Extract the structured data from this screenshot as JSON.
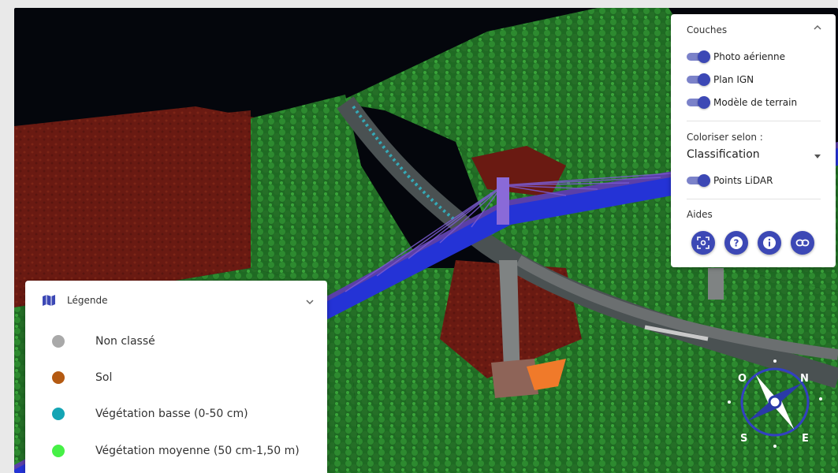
{
  "layers_panel": {
    "title": "Couches",
    "toggles": [
      {
        "label": "Photo aérienne",
        "on": true
      },
      {
        "label": "Plan IGN",
        "on": true
      },
      {
        "label": "Modèle de terrain",
        "on": true
      }
    ],
    "colorize_label": "Coloriser selon :",
    "colorize_value": "Classification",
    "lidar_toggle": {
      "label": "Points LiDAR",
      "on": true
    },
    "aides_label": "Aides",
    "aides_buttons": [
      "focus-icon",
      "help-icon",
      "info-icon",
      "link-icon"
    ]
  },
  "legend": {
    "title": "Légende",
    "items": [
      {
        "label": "Non classé",
        "color": "#a9a9a9"
      },
      {
        "label": "Sol",
        "color": "#b45a12"
      },
      {
        "label": "Végétation basse (0-50 cm)",
        "color": "#14a5b4"
      },
      {
        "label": "Végétation moyenne (50 cm-1,50 m)",
        "color": "#46f046"
      }
    ]
  },
  "compass": {
    "letters": [
      "O",
      "N",
      "E",
      "S"
    ]
  },
  "colors": {
    "accent": "#3c48b5",
    "accent_light": "#7b82c9"
  }
}
